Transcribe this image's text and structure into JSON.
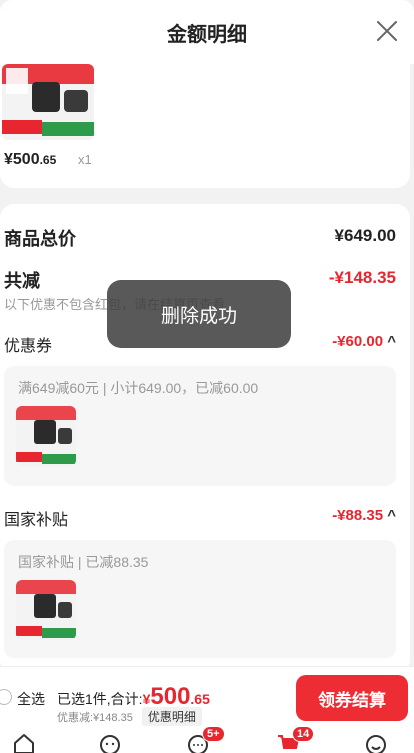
{
  "header": {
    "title": "金额明细",
    "close_icon": "close-icon"
  },
  "top_product": {
    "price_main": "¥500",
    "price_decimal": ".65",
    "quantity": "x1"
  },
  "summary": {
    "total_label": "商品总价",
    "total_value": "¥649.00",
    "reduce_label": "共减",
    "reduce_value": "-¥148.35",
    "reduce_note": "以下优惠不包含红包，请在结算页查看"
  },
  "coupon": {
    "label": "优惠券",
    "value": "-¥60.00",
    "detail": "满649减60元 | 小计649.00，已减60.00"
  },
  "subsidy": {
    "label": "国家补贴",
    "value": "-¥88.35",
    "detail": "国家补贴 | 已减88.35"
  },
  "toast": {
    "text": "删除成功"
  },
  "bottom_bar": {
    "select_all": "全选",
    "selected_prefix": "已选1件,合计:",
    "total_currency": "¥",
    "total_main": "500",
    "total_decimal": ".65",
    "discount_text": "优惠减:¥148.35",
    "detail_link": "优惠明细",
    "checkout_label": "领券结算"
  },
  "tabbar": {
    "tabs": [
      {
        "icon": "home-icon"
      },
      {
        "icon": "face-icon"
      },
      {
        "icon": "message-icon",
        "badge": "5+"
      },
      {
        "icon": "cart-icon",
        "badge": "14"
      },
      {
        "icon": "profile-icon"
      }
    ]
  },
  "colors": {
    "accent": "#e8262f",
    "checkout": "#ee2c33"
  }
}
